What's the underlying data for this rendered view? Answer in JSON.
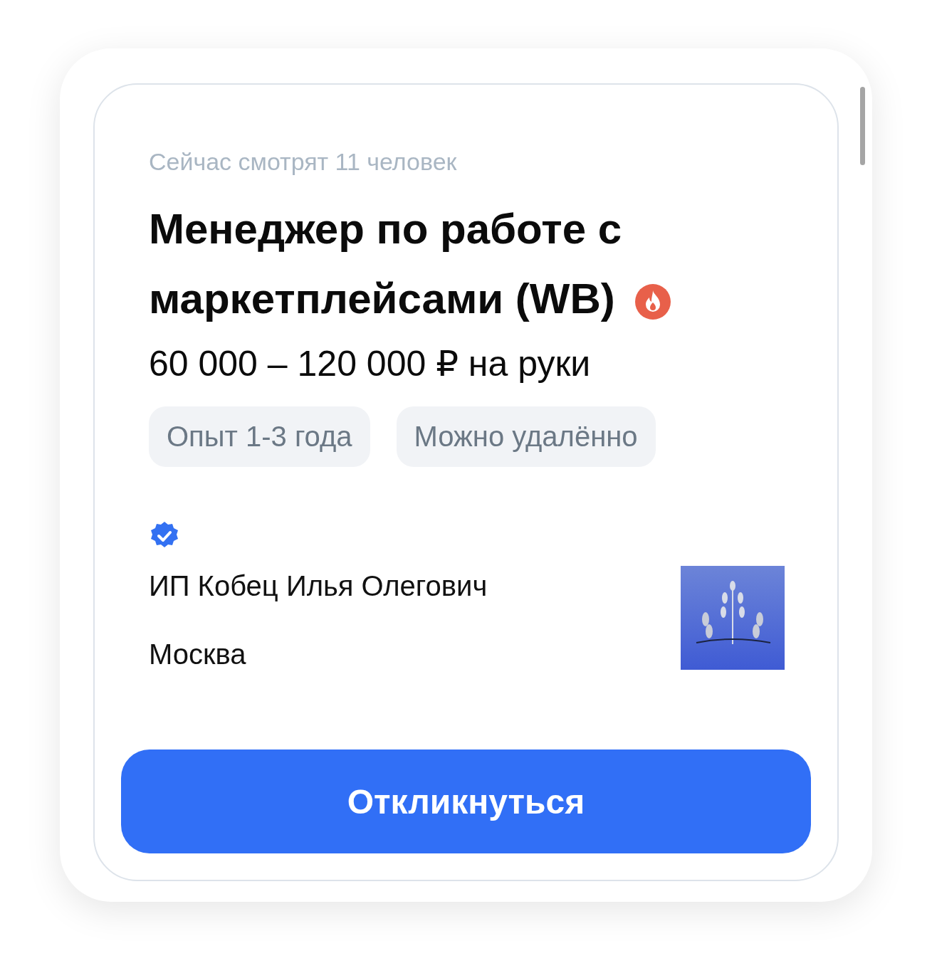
{
  "viewers": "Сейчас смотрят 11 человек",
  "title": "Менеджер по работе с маркетплейсами (WB)",
  "salary": "60 000 – 120 000 ₽ на руки",
  "tags": [
    "Опыт 1-3 года",
    "Можно удалённо"
  ],
  "employer": {
    "name": "ИП Кобец Илья Олегович",
    "city": "Москва"
  },
  "button": "Откликнуться"
}
